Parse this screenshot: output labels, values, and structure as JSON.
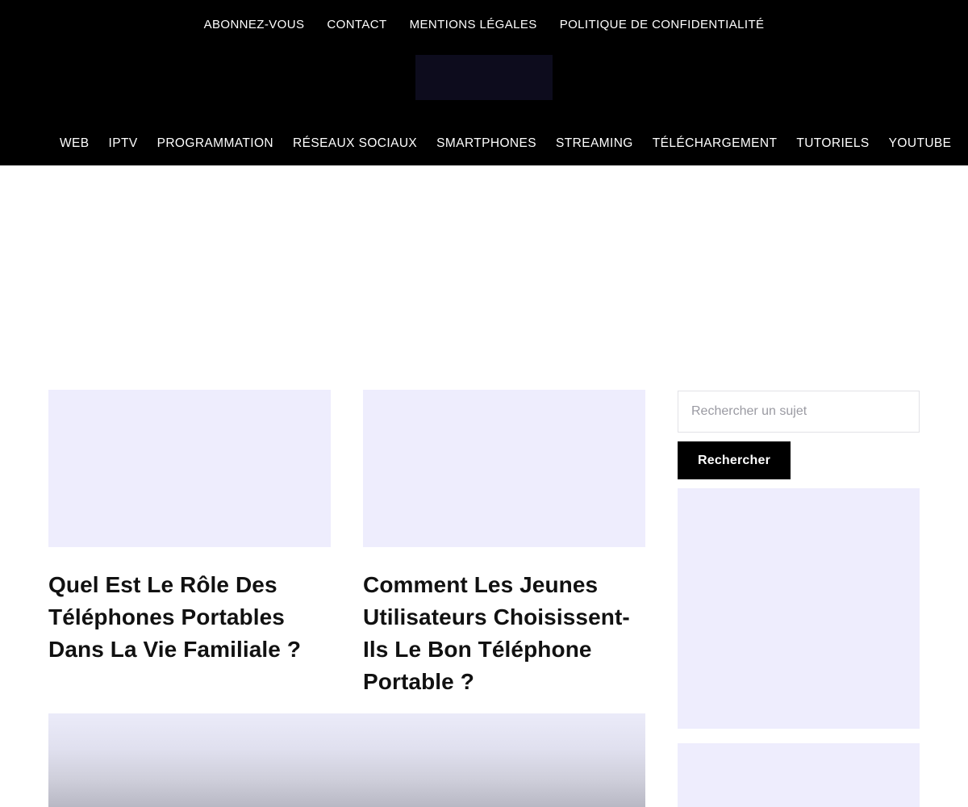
{
  "header": {
    "background_color": "#000000",
    "logo": {
      "name": "site-logo",
      "color": "#0d0c1d"
    },
    "top_nav": [
      {
        "label": "ABONNEZ-VOUS"
      },
      {
        "label": "CONTACT"
      },
      {
        "label": "MENTIONS LÉGALES"
      },
      {
        "label": "POLITIQUE DE CONFIDENTIALITÉ"
      }
    ],
    "main_nav": [
      {
        "label": "WEB"
      },
      {
        "label": "IPTV"
      },
      {
        "label": "PROGRAMMATION"
      },
      {
        "label": "RÉSEAUX SOCIAUX"
      },
      {
        "label": "SMARTPHONES"
      },
      {
        "label": "STREAMING"
      },
      {
        "label": "TÉLÉCHARGEMENT"
      },
      {
        "label": "TUTORIELS"
      },
      {
        "label": "YOUTUBE"
      }
    ]
  },
  "main": {
    "posts": [
      {
        "title": "Quel Est Le Rôle Des Téléphones Portables Dans La Vie Familiale ?"
      },
      {
        "title": "Comment Les Jeunes Utilisateurs Choisissent-Ils Le Bon Téléphone Portable ?"
      }
    ],
    "placeholder_color": "#eeedfd",
    "gradient_block": {
      "from": "#ebebf9",
      "to": "#b8b8c4"
    }
  },
  "sidebar": {
    "search": {
      "placeholder": "Rechercher un sujet",
      "value": "",
      "button_label": "Rechercher",
      "button_color": "#000000"
    },
    "widgets": [
      {
        "name": "sidebar-widget-1"
      },
      {
        "name": "sidebar-widget-2"
      }
    ]
  }
}
